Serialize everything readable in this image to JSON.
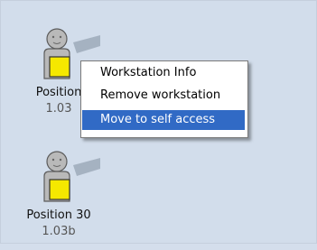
{
  "workstations": [
    {
      "name": "Position",
      "version": "1.03"
    },
    {
      "name": "Position 30",
      "version": "1.03b"
    }
  ],
  "context_menu": {
    "items": [
      {
        "label": "Workstation Info"
      },
      {
        "label": "Remove workstation"
      },
      {
        "label": "Move to self access"
      }
    ],
    "selected_index": 2
  },
  "icons": {
    "workstation": "user-with-yellow-box-icon"
  },
  "colors": {
    "background": "#d2ddeb",
    "selection": "#316ac5",
    "icon_box": "#f5e800"
  }
}
